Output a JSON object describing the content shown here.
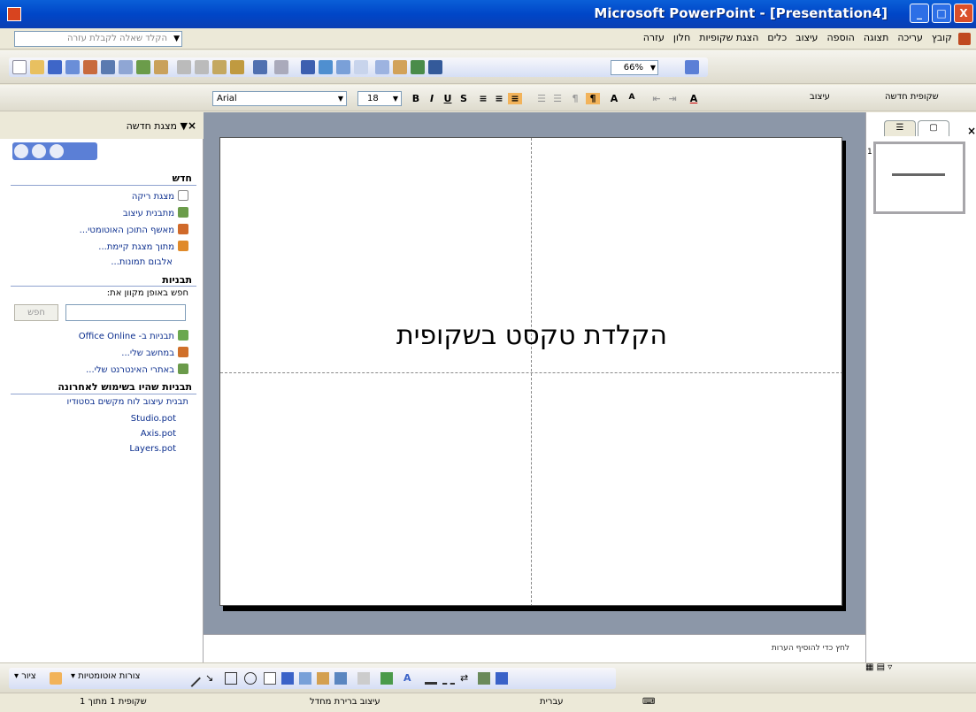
{
  "window": {
    "title": "Microsoft PowerPoint - [Presentation4]",
    "minimize": "_",
    "maximize": "□",
    "close": "X"
  },
  "menu": {
    "help_placeholder": "הקלד שאלה לקבלת עזרה",
    "items": [
      "קובץ",
      "עריכה",
      "תצוגה",
      "הוספה",
      "עיצוב",
      "כלים",
      "הצגת שקופיות",
      "חלון",
      "עזרה"
    ]
  },
  "toolbar": {
    "zoom": "66%",
    "font": "Arial",
    "font_size": "18",
    "design_label": "עיצוב",
    "new_slide_label": "שקופית חדשה"
  },
  "taskpane": {
    "title": "מצגת חדשה",
    "sections": {
      "new": "חדש",
      "templates": "תבניות",
      "recent": "תבניות שהיו בשימוש לאחרונה"
    },
    "new_links": [
      "מצגת ריקה",
      "מתבנית עיצוב",
      "מאשף התוכן האוטומטי...",
      "מתוך מצגת קיימת...",
      "אלבום תמונות..."
    ],
    "search_label": "חפש באופן מקוון את:",
    "search_button": "חפש",
    "template_links": [
      "תבניות ב- Office Online",
      "במחשב שלי...",
      "באתרי האינטרנט שלי..."
    ],
    "recent_links": [
      "תבנית עיצוב לוח מקשים בסטודיו",
      "Studio.pot",
      "Axis.pot",
      "Layers.pot"
    ]
  },
  "slide": {
    "title_placeholder": "הקלדת טקסט בשקופית"
  },
  "notes": {
    "hint": "לחץ כדי להוסיף הערות"
  },
  "slides_pane": {
    "thumb_number": "1"
  },
  "drawing_toolbar": {
    "draw_label": "ציור",
    "autoshapes_label": "צורות אוטומטיות"
  },
  "statusbar": {
    "slide_count": "שקופית 1 מתוך 1",
    "design": "עיצוב ברירת מחדל",
    "language": "עברית"
  },
  "colors": {
    "titlebar": "#0046c8",
    "slide_area": "#8c97a8",
    "close_button": "#d94f2a"
  }
}
